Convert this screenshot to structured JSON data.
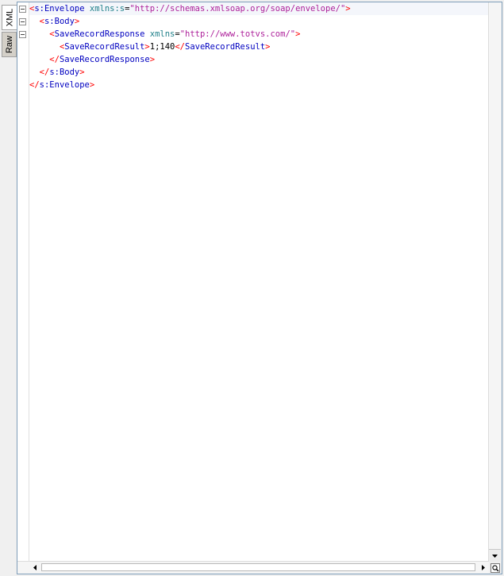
{
  "tabs": [
    {
      "label": "XML",
      "active": true
    },
    {
      "label": "Raw",
      "active": false
    }
  ],
  "lines": [
    {
      "indent": 0,
      "tokens": [
        {
          "t": "br",
          "v": "<"
        },
        {
          "t": "tg",
          "v": "s:Envelope"
        },
        {
          "t": "sp",
          "v": " "
        },
        {
          "t": "an",
          "v": "xmlns:s"
        },
        {
          "t": "eq",
          "v": "="
        },
        {
          "t": "av",
          "v": "\"http://schemas.xmlsoap.org/soap/envelope/\""
        },
        {
          "t": "br",
          "v": ">"
        }
      ]
    },
    {
      "indent": 2,
      "tokens": [
        {
          "t": "br",
          "v": "<"
        },
        {
          "t": "tg",
          "v": "s:Body"
        },
        {
          "t": "br",
          "v": ">"
        }
      ]
    },
    {
      "indent": 4,
      "tokens": [
        {
          "t": "br",
          "v": "<"
        },
        {
          "t": "tg",
          "v": "SaveRecordResponse"
        },
        {
          "t": "sp",
          "v": " "
        },
        {
          "t": "an",
          "v": "xmlns"
        },
        {
          "t": "eq",
          "v": "="
        },
        {
          "t": "av",
          "v": "\"http://www.totvs.com/\""
        },
        {
          "t": "br",
          "v": ">"
        }
      ]
    },
    {
      "indent": 6,
      "tokens": [
        {
          "t": "br",
          "v": "<"
        },
        {
          "t": "tg",
          "v": "SaveRecordResult"
        },
        {
          "t": "br",
          "v": ">"
        },
        {
          "t": "tx",
          "v": "1;140"
        },
        {
          "t": "br",
          "v": "</"
        },
        {
          "t": "tg",
          "v": "SaveRecordResult"
        },
        {
          "t": "br",
          "v": ">"
        }
      ]
    },
    {
      "indent": 4,
      "tokens": [
        {
          "t": "br",
          "v": "</"
        },
        {
          "t": "tg",
          "v": "SaveRecordResponse"
        },
        {
          "t": "br",
          "v": ">"
        }
      ]
    },
    {
      "indent": 2,
      "tokens": [
        {
          "t": "br",
          "v": "</"
        },
        {
          "t": "tg",
          "v": "s:Body"
        },
        {
          "t": "br",
          "v": ">"
        }
      ]
    },
    {
      "indent": 0,
      "tokens": [
        {
          "t": "br",
          "v": "</"
        },
        {
          "t": "tg",
          "v": "s:Envelope"
        },
        {
          "t": "br",
          "v": ">"
        }
      ]
    }
  ],
  "colors": {
    "bracket": "#ff0000",
    "tag": "#0000c0",
    "attr_name": "#20808a",
    "attr_value": "#ad1f9a",
    "text": "#000000"
  },
  "icons": {
    "fold": "minus-box-icon",
    "scroll_down": "arrow-down-icon",
    "scroll_left": "arrow-left-icon",
    "scroll_right": "arrow-right-icon",
    "corner": "magnifier-icon"
  }
}
